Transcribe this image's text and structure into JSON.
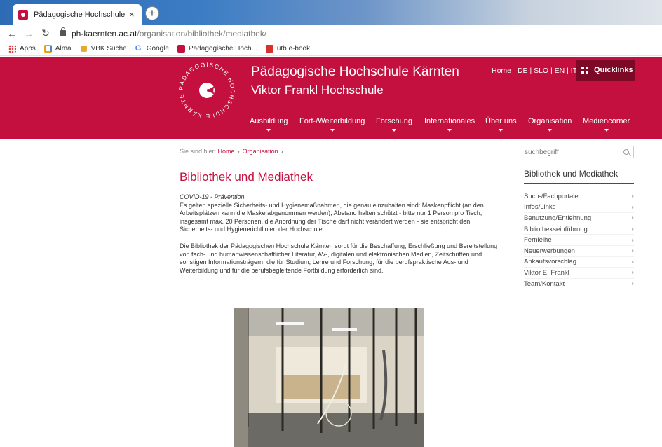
{
  "browser": {
    "tab_title": "Pädagogische Hochschule Kärnten",
    "tab_close": "×",
    "new_tab": "+",
    "url_host": "ph-kaernten.ac.at",
    "url_path": "/organisation/bibliothek/mediathek/",
    "bookmarks": [
      {
        "label": "Apps",
        "icon": "apps-grid-icon"
      },
      {
        "label": "Alma",
        "icon": "alma-icon"
      },
      {
        "label": "VBK Suche",
        "icon": "vbk-icon"
      },
      {
        "label": "Google",
        "icon": "google-icon"
      },
      {
        "label": "Pädagogische Hoch...",
        "icon": "ph-icon"
      },
      {
        "label": "utb e-book",
        "icon": "utb-icon"
      }
    ]
  },
  "header": {
    "title": "Pädagogische Hochschule Kärnten",
    "subtitle": "Viktor Frankl Hochschule",
    "logo_text": "PÄDAGOGISCHE HOCHSCHULE KÄRNTEN",
    "top_links": [
      "Home",
      "DE | SLO | EN | IT"
    ],
    "quicklinks": "Quicklinks",
    "nav": [
      "Ausbildung",
      "Fort-/Weiterbildung",
      "Forschung",
      "Internationales",
      "Über uns",
      "Organisation",
      "Mediencorner"
    ],
    "accent": "#c3103f"
  },
  "breadcrumb": {
    "prefix": "Sie sind hier:",
    "items": [
      "Home",
      "Organisation"
    ],
    "sep": "›"
  },
  "content": {
    "title": "Bibliothek und Mediathek",
    "covid_heading": "COVID-19 - Prävention",
    "covid_text": "Es gelten spezielle Sicherheits- und Hygienemaßnahmen, die genau einzuhalten sind: Maskenpflicht (an den Arbeitsplätzen kann die Maske abgenommen werden), Abstand halten schützt - bitte nur 1 Person pro Tisch, insgesamt max. 20 Personen, die Anordnung der Tische darf nicht verändert werden - sie entspricht den Sicherheits- und Hygienerichtlinien der Hochschule.",
    "intro": "Die Bibliothek der Pädagogischen Hochschule Kärnten sorgt für die Beschaffung, Erschließung und Bereitstellung von fach- und humanwissenschaftlicher Literatur, AV-, digitalen und elektronischen Medien, Zeitschriften und sonstigen Informationsträgern, die für Studium, Lehre und Forschung, für die berufspraktische Aus- und Weiterbildung und für die berufsbegleitende Fortbildung erforderlich sind."
  },
  "sidebar": {
    "search_placeholder": "suchbegriff",
    "title": "Bibliothek und Mediathek",
    "items": [
      "Such-/Fachportale",
      "Infos/Links",
      "Benutzung/Entlehnung",
      "Bibliothekseinführung",
      "Fernleihe",
      "Neuerwerbungen",
      "Ankaufsvorschlag",
      "Viktor E. Frankl",
      "Team/Kontakt"
    ]
  }
}
